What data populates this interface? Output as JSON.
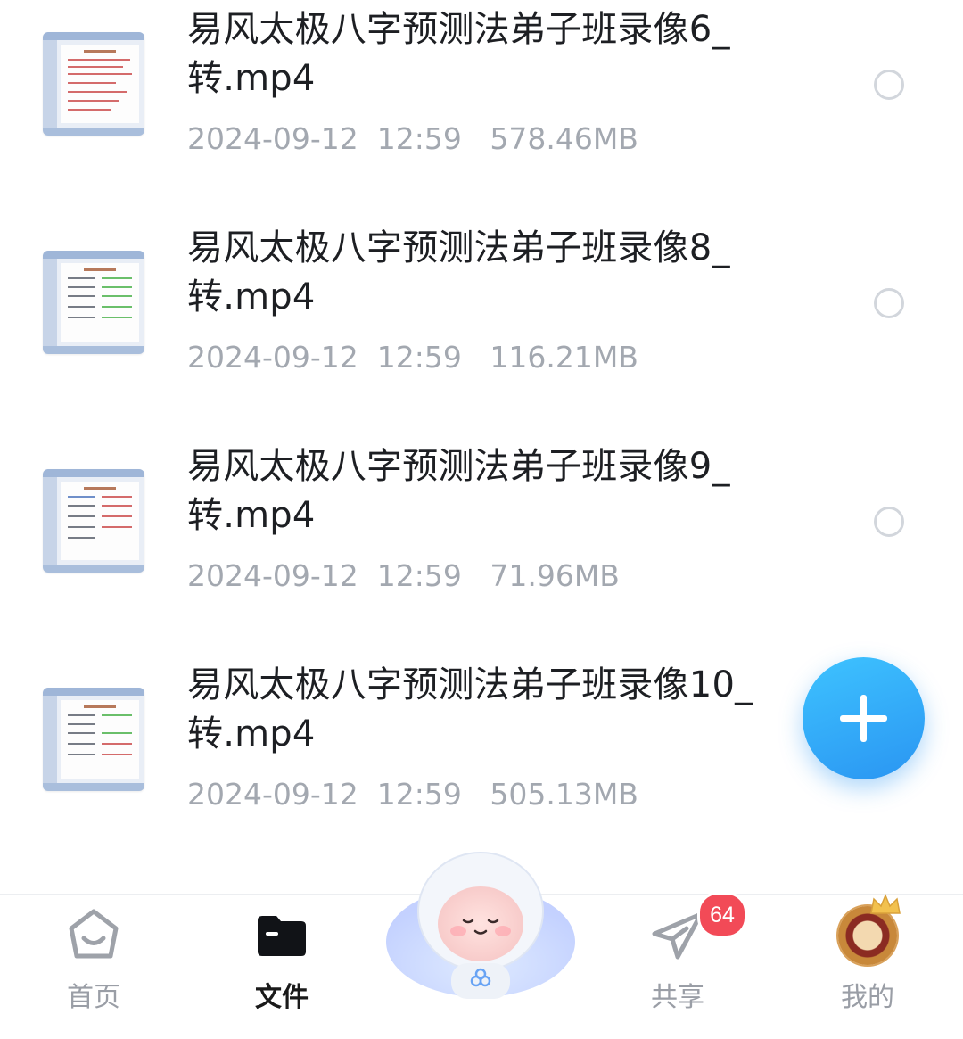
{
  "files": [
    {
      "name": "易风太极八字预测法弟子班录像6_转.mp4",
      "date": "2024-09-12",
      "time": "12:59",
      "size": "578.46MB"
    },
    {
      "name": "易风太极八字预测法弟子班录像8_转.mp4",
      "date": "2024-09-12",
      "time": "12:59",
      "size": "116.21MB"
    },
    {
      "name": "易风太极八字预测法弟子班录像9_转.mp4",
      "date": "2024-09-12",
      "time": "12:59",
      "size": "71.96MB"
    },
    {
      "name": "易风太极八字预测法弟子班录像10_转.mp4",
      "date": "2024-09-12",
      "time": "12:59",
      "size": "505.13MB"
    }
  ],
  "fab": {
    "icon": "plus-icon",
    "color": "#2a95f2"
  },
  "nav": {
    "home": {
      "label": "首页",
      "icon": "home-icon"
    },
    "files": {
      "label": "文件",
      "icon": "folder-icon",
      "active": true
    },
    "assistant": {
      "icon": "mascot-avatar"
    },
    "share": {
      "label": "共享",
      "icon": "paper-plane-icon",
      "badge": "64"
    },
    "me": {
      "label": "我的",
      "icon": "user-avatar"
    }
  },
  "colors": {
    "badge": "#f24a57",
    "text_primary": "#1d1f23",
    "text_meta": "#a3a8b0"
  }
}
